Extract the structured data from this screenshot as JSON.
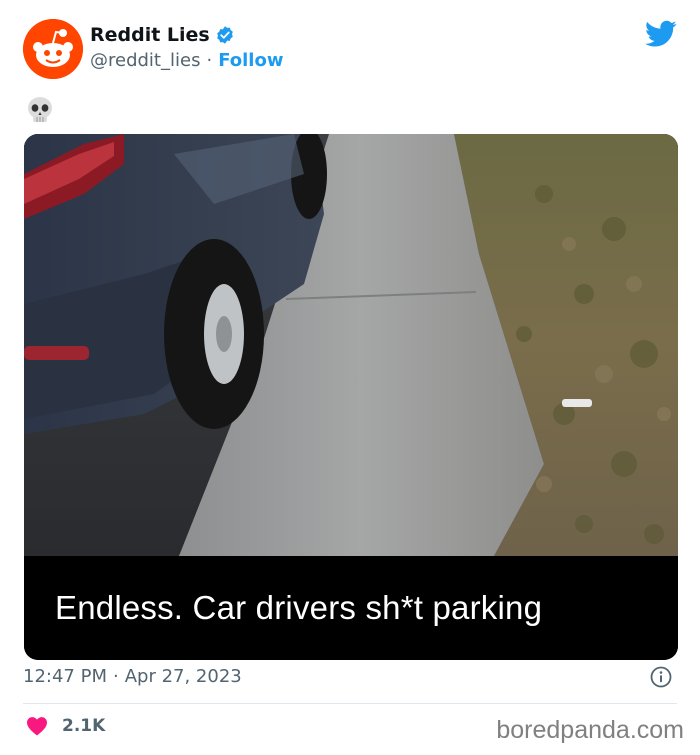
{
  "tweet": {
    "author_name": "Reddit Lies",
    "handle": "@reddit_lies",
    "separator": "·",
    "follow_label": "Follow",
    "emoji": "💀",
    "image_caption": "Endless. Car drivers sh*t parking",
    "time": "12:47 PM",
    "date": "Apr 27, 2023",
    "like_count": "2.1K"
  },
  "icons": {
    "avatar": "reddit-alien-avatar",
    "verified": "verified-badge-icon",
    "brand": "twitter-bird-icon",
    "info": "info-icon",
    "like": "heart-icon"
  },
  "colors": {
    "accent": "#1d9bf0",
    "reddit_orange": "#ff4500",
    "heart": "#f91880",
    "secondary_text": "#536471"
  },
  "watermark": "boredpanda.com"
}
